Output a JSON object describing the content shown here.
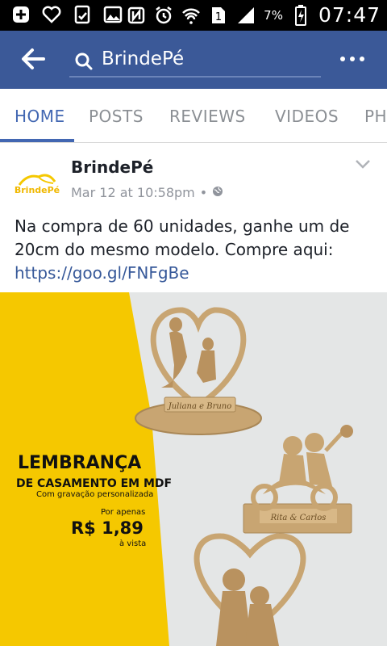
{
  "status_bar": {
    "battery_percent": "7%",
    "time": "07:47",
    "sim_number": "1"
  },
  "app_bar": {
    "search_query": "BrindePé"
  },
  "tabs": [
    "HOME",
    "POSTS",
    "REVIEWS",
    "VIDEOS",
    "PH"
  ],
  "active_tab": "HOME",
  "post": {
    "page_name": "BrindePé",
    "avatar_text": "BrindePé",
    "timestamp": "Mar 12 at 10:58pm",
    "separator": "•",
    "text": "Na compra de 60 unidades, ganhe um de 20cm do mesmo modelo. Compre aqui:",
    "link": "https://goo.gl/FNFgBe"
  },
  "ad_image": {
    "headline": "LEMBRANÇA",
    "subheadline": "DE CASAMENTO EM MDF",
    "tagline": "Com gravação personalizada",
    "price_prefix": "Por apenas",
    "price": "R$ 1,89",
    "price_suffix": "à vista",
    "plaque_top": "Juliana e Bruno",
    "plaque_mid": "Rita & Carlos",
    "colors": {
      "yellow": "#f5c800",
      "wood": "#c8a572",
      "background": "#e4e6e6"
    }
  },
  "colors": {
    "app_bar": "#3b5998",
    "accent": "#4267b2",
    "link": "#365899"
  }
}
